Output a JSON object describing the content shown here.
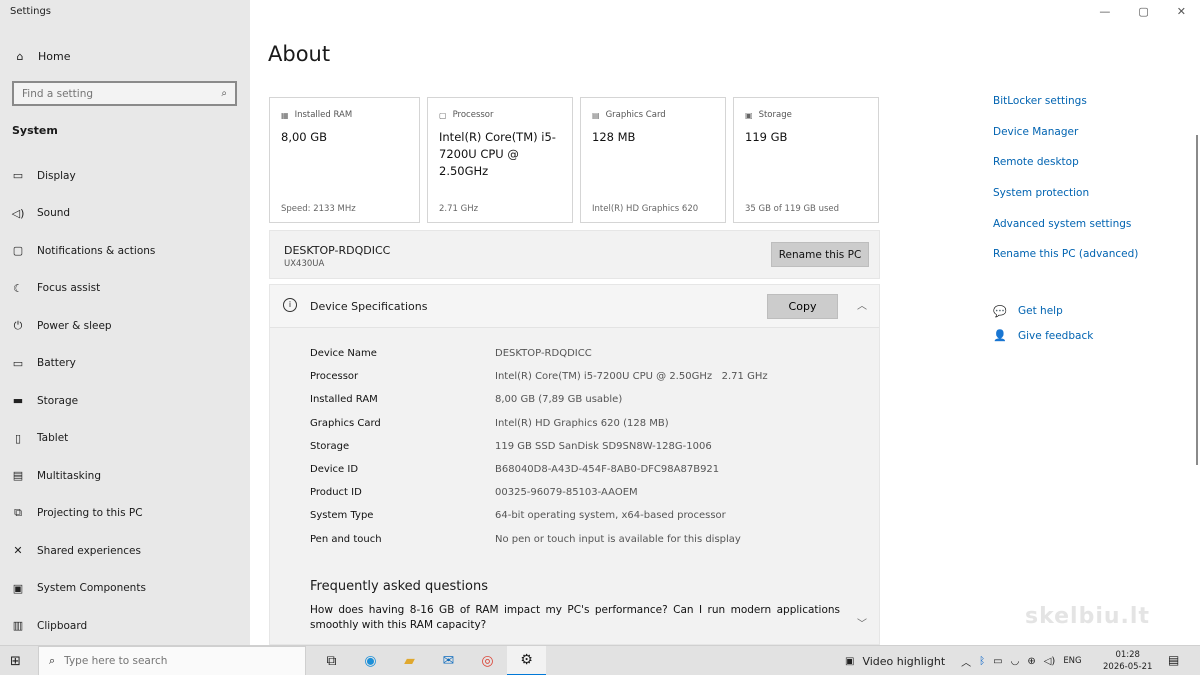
{
  "app": {
    "title": "Settings"
  },
  "window": {
    "minimize": "—",
    "maximize": "▢",
    "close": "✕"
  },
  "sidebar": {
    "home": "Home",
    "search_placeholder": "Find a setting",
    "section": "System",
    "items": [
      {
        "label": "Display",
        "icon": "display-icon"
      },
      {
        "label": "Sound",
        "icon": "sound-icon"
      },
      {
        "label": "Notifications & actions",
        "icon": "notifications-icon"
      },
      {
        "label": "Focus assist",
        "icon": "focus-assist-icon"
      },
      {
        "label": "Power & sleep",
        "icon": "power-icon"
      },
      {
        "label": "Battery",
        "icon": "battery-icon"
      },
      {
        "label": "Storage",
        "icon": "storage-icon"
      },
      {
        "label": "Tablet",
        "icon": "tablet-icon"
      },
      {
        "label": "Multitasking",
        "icon": "multitasking-icon"
      },
      {
        "label": "Projecting to this PC",
        "icon": "projecting-icon"
      },
      {
        "label": "Shared experiences",
        "icon": "shared-icon"
      },
      {
        "label": "System Components",
        "icon": "components-icon"
      },
      {
        "label": "Clipboard",
        "icon": "clipboard-icon"
      }
    ]
  },
  "main": {
    "title": "About",
    "cards": [
      {
        "label": "Installed RAM",
        "value": "8,00 GB",
        "sub": "Speed: 2133 MHz"
      },
      {
        "label": "Processor",
        "value": "Intel(R) Core(TM) i5-7200U CPU @ 2.50GHz",
        "sub": "2.71 GHz"
      },
      {
        "label": "Graphics Card",
        "value": "128 MB",
        "sub": "Intel(R) HD Graphics 620"
      },
      {
        "label": "Storage",
        "value": "119 GB",
        "sub": "35 GB of 119 GB used"
      }
    ],
    "pc": {
      "name": "DESKTOP-RDQDICC",
      "model": "UX430UA",
      "rename_button": "Rename this PC"
    },
    "specs": {
      "title": "Device Specifications",
      "copy_button": "Copy",
      "rows": [
        {
          "key": "Device Name",
          "value": "DESKTOP-RDQDICC"
        },
        {
          "key": "Processor",
          "value": "Intel(R) Core(TM) i5-7200U CPU @ 2.50GHz   2.71 GHz"
        },
        {
          "key": "Installed RAM",
          "value": "8,00 GB (7,89 GB usable)"
        },
        {
          "key": "Graphics Card",
          "value": "Intel(R) HD Graphics 620 (128 MB)"
        },
        {
          "key": "Storage",
          "value": "119 GB SSD SanDisk SD9SN8W-128G-1006"
        },
        {
          "key": "Device ID",
          "value": "B68040D8-A43D-454F-8AB0-DFC98A87B921"
        },
        {
          "key": "Product ID",
          "value": "00325-96079-85103-AAOEM"
        },
        {
          "key": "System Type",
          "value": "64-bit operating system, x64-based processor"
        },
        {
          "key": "Pen and touch",
          "value": "No pen or touch input is available for this display"
        }
      ],
      "faq_title": "Frequently asked questions",
      "faq_question": "How does having 8-16 GB of RAM impact my PC's performance? Can I run modern applications smoothly with this RAM capacity?"
    }
  },
  "related": {
    "links": [
      "BitLocker settings",
      "Device Manager",
      "Remote desktop",
      "System protection",
      "Advanced system settings",
      "Rename this PC (advanced)"
    ],
    "help": [
      {
        "label": "Get help",
        "icon": "help-chat-icon"
      },
      {
        "label": "Give feedback",
        "icon": "feedback-icon"
      }
    ]
  },
  "watermark": "skelbiu.lt",
  "taskbar": {
    "search_placeholder": "Type here to search",
    "video_highlight": "Video highlight",
    "lang": "ENG",
    "time": "01:28",
    "date": "2026-05-21"
  }
}
